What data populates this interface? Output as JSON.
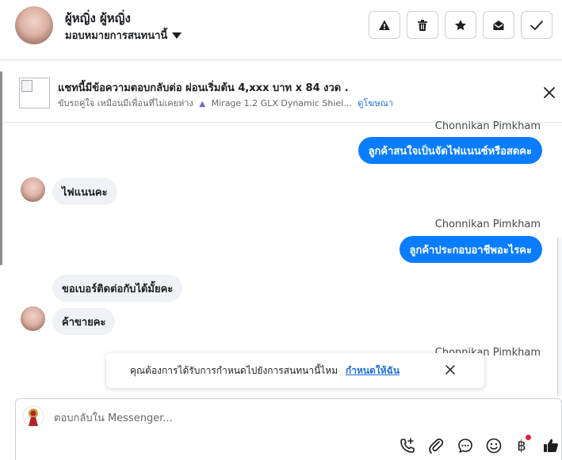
{
  "header": {
    "contact_name": "ผู้หญิ่ง ผู้หญิ่ง",
    "assign_label": "มอบหมายการสนทนานี้",
    "actions": [
      {
        "icon": "warning-icon"
      },
      {
        "icon": "trash-icon"
      },
      {
        "icon": "star-icon"
      },
      {
        "icon": "envelope-open-icon"
      },
      {
        "icon": "check-icon"
      }
    ]
  },
  "ad": {
    "title": "แชทนี้มีข้อความตอบกลับต่อ ผ่อนเริ่มต้น 4,xxx บาท x 84 งวด .",
    "subtitle_text": "ขับรถคู่ใจ เหมือนมีเพื่อนที่ไม่เคยห่าง",
    "subtitle_car": "Mirage 1.2 GLX Dynamic Shiel...",
    "link": "ดูโฆษณา",
    "car_icon": "car-icon"
  },
  "messages": [
    {
      "sender": "Chonnikan Pimkham",
      "text": "ลูกค้าสนใจเป็นจัดไฟแนนซ์หรือสดคะ"
    },
    {
      "text": "ไฟแนนคะ"
    },
    {
      "sender": "Chonnikan Pimkham",
      "text": "ลูกค้าประกอบอาชีพอะไรคะ"
    },
    {
      "text": "ขอเบอร์ติดต่อกับได้มั้ยคะ"
    },
    {
      "text": "ค้าขายคะ"
    },
    {
      "sender": "Chonnikan Pimkham"
    }
  ],
  "toast": {
    "text": "คุณต้องการได้รับการกำหนดไปยังการสนทนานี้ไหม",
    "link": "กำหนดให้ฉัน"
  },
  "composer": {
    "placeholder": "ตอบกลับใน Messenger...",
    "tools": [
      "phone-add-icon",
      "attachment-icon",
      "faq-bubble-icon",
      "emoji-icon",
      "baht-payment-icon",
      "thumbs-up-icon"
    ],
    "baht_symbol": "฿"
  },
  "colors": {
    "outgoing_bubble": "#0a7cff",
    "incoming_bubble": "#f0f2f5",
    "link": "#216fdb",
    "notification_dot": "#e41e3f"
  }
}
